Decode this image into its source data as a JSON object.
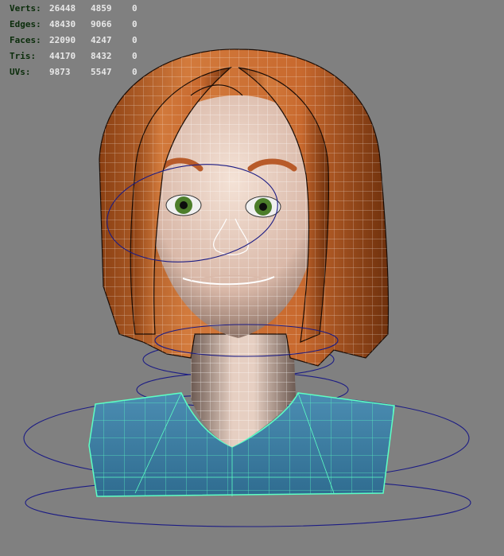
{
  "hud": {
    "rows": [
      {
        "label": "Verts:",
        "v1": "26448",
        "v2": "4859",
        "v3": "0"
      },
      {
        "label": "Edges:",
        "v1": "48430",
        "v2": "9066",
        "v3": "0"
      },
      {
        "label": "Faces:",
        "v1": "22090",
        "v2": "4247",
        "v3": "0"
      },
      {
        "label": "Tris:",
        "v1": "44170",
        "v2": "8432",
        "v3": "0"
      },
      {
        "label": "UVs:",
        "v1": "9873",
        "v2": "5547",
        "v3": "0"
      }
    ]
  },
  "colors": {
    "viewport_bg": "#808080",
    "hair": "#b8612a",
    "skin": "#e9d3c6",
    "shirt": "#3c7fa4",
    "wire_white": "#ffffff",
    "wire_selected": "#54ffc8",
    "controls": "#1a1a80",
    "eyes": "#4c7d2a"
  },
  "icons": {
    "scene": "maya-viewport-character-mesh"
  }
}
